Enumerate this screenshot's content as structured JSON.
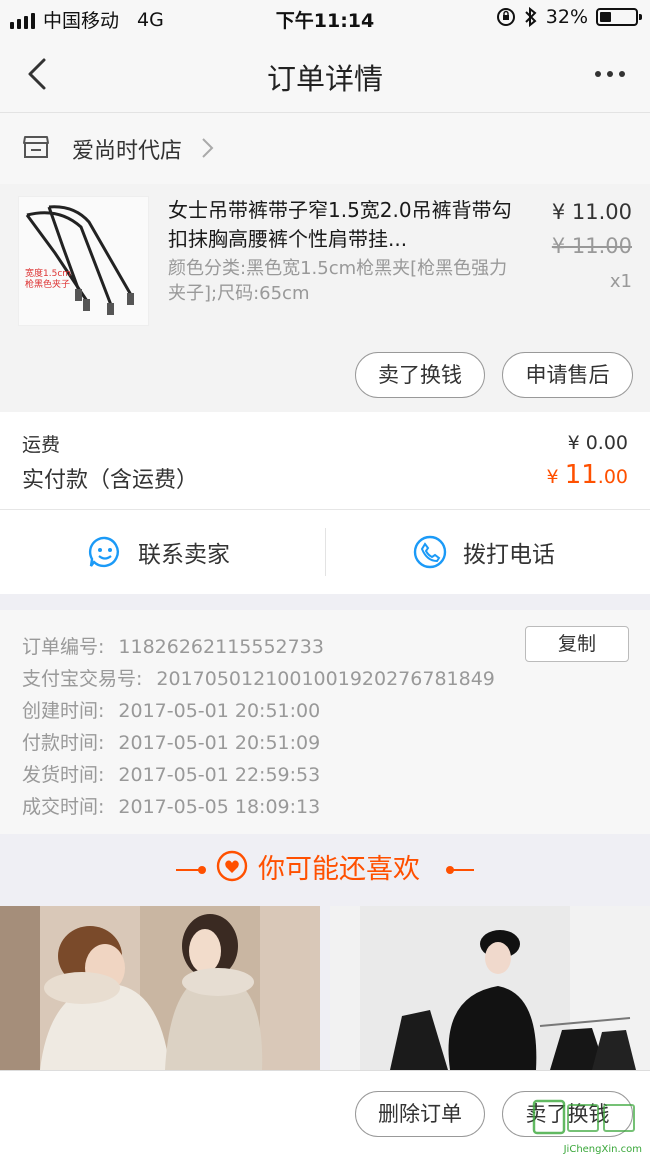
{
  "status_bar": {
    "carrier": "中国移动",
    "network": "4G",
    "time": "下午11:14",
    "battery": "32%",
    "battery_level": 0.32
  },
  "nav": {
    "title": "订单详情"
  },
  "store": {
    "name": "爱尚时代店"
  },
  "product": {
    "title": "女士吊带裤带子窄1.5宽2.0吊裤背带勾扣抹胸高腰裤个性肩带挂...",
    "spec": "颜色分类:黑色宽1.5cm枪黑夹[枪黑色强力夹子];尺码:65cm",
    "price": "¥ 11.00",
    "original_price": "¥ 11.00",
    "quantity": "x1",
    "thumb_note_1": "宽度1.5cm",
    "thumb_note_2": "枪黑色夹子",
    "buttons": {
      "resell": "卖了换钱",
      "after_sale": "申请售后"
    }
  },
  "fees": {
    "shipping_label": "运费",
    "shipping_value": "¥ 0.00",
    "paid_label": "实付款（含运费）",
    "paid_currency": "¥ ",
    "paid_integer": "11",
    "paid_decimal": ".00"
  },
  "contact": {
    "seller": "联系卖家",
    "phone": "拨打电话"
  },
  "order_info": {
    "copy_label": "复制",
    "rows": [
      {
        "label": "订单编号:",
        "value": "11826262115552733"
      },
      {
        "label": "支付宝交易号:",
        "value": "2017050121001001920276781849"
      },
      {
        "label": "创建时间:",
        "value": "2017-05-01 20:51:00"
      },
      {
        "label": "付款时间:",
        "value": "2017-05-01 20:51:09"
      },
      {
        "label": "发货时间:",
        "value": "2017-05-01 22:59:53"
      },
      {
        "label": "成交时间:",
        "value": "2017-05-05 18:09:13"
      }
    ]
  },
  "recommend": {
    "title": "你可能还喜欢",
    "accent": "#ff5000"
  },
  "bottom_bar": {
    "delete": "删除订单",
    "resell": "卖了换钱"
  },
  "watermark": {
    "text": "JiChengXin.com"
  }
}
